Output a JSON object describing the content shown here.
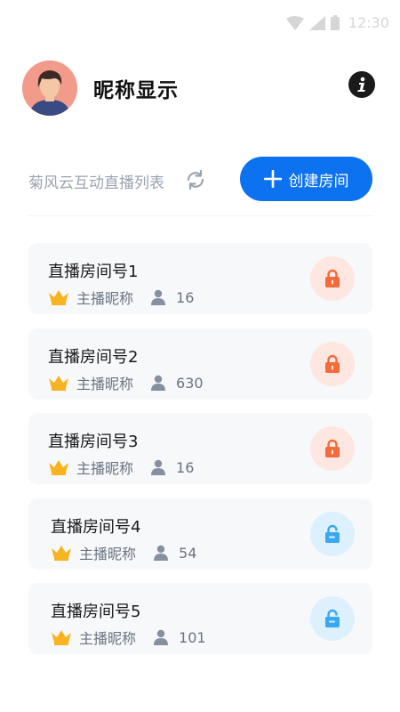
{
  "status_bar": {
    "time": "12:30"
  },
  "header": {
    "nickname": "昵称显示"
  },
  "list": {
    "title": "菊风云互动直播列表",
    "create_label": "创建房间",
    "rooms": [
      {
        "name": "直播房间号1",
        "host": "主播昵称",
        "viewers": "16",
        "locked": true
      },
      {
        "name": "直播房间号2",
        "host": "主播昵称",
        "viewers": "630",
        "locked": true
      },
      {
        "name": "直播房间号3",
        "host": "主播昵称",
        "viewers": "16",
        "locked": true
      },
      {
        "name": "直播房间号4",
        "host": "主播昵称",
        "viewers": "54",
        "locked": false
      },
      {
        "name": "直播房间号5",
        "host": "主播昵称",
        "viewers": "101",
        "locked": false
      }
    ]
  },
  "colors": {
    "accent": "#0d72f0",
    "locked": "#f26b3a",
    "unlocked": "#3aa8f0",
    "crown": "#f7b320"
  }
}
